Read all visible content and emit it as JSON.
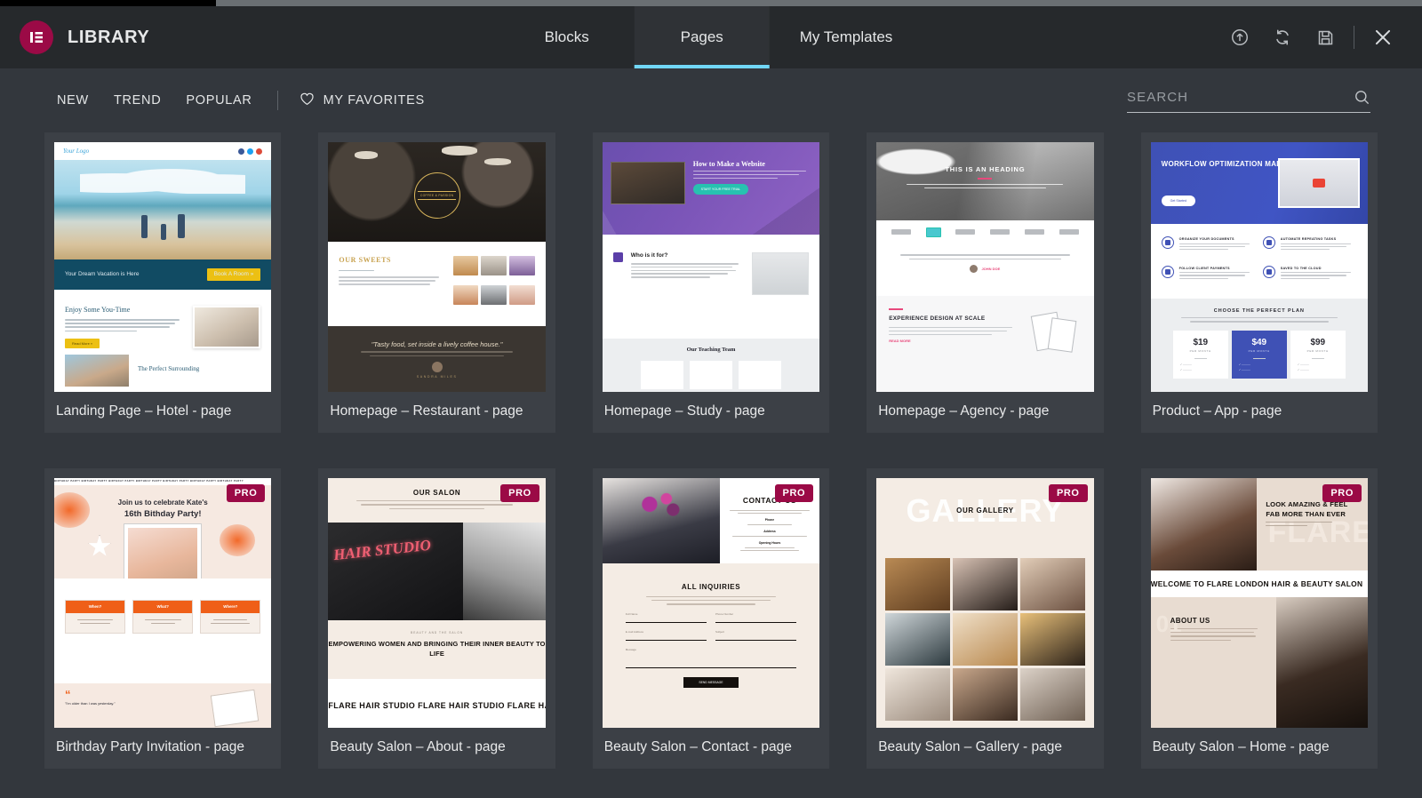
{
  "header": {
    "brand": "LIBRARY",
    "logo_color": "#9b0a46",
    "tabs": [
      {
        "label": "Blocks",
        "active": false
      },
      {
        "label": "Pages",
        "active": true
      },
      {
        "label": "My Templates",
        "active": false
      }
    ],
    "active_tab_underline_color": "#71d7f7",
    "actions": [
      {
        "name": "import-template-icon",
        "title": "Import Template"
      },
      {
        "name": "sync-library-icon",
        "title": "Sync Library"
      },
      {
        "name": "save-template-icon",
        "title": "Save"
      },
      {
        "name": "close-icon",
        "title": "Close"
      }
    ]
  },
  "toolbar": {
    "filters": [
      {
        "label": "NEW"
      },
      {
        "label": "TREND"
      },
      {
        "label": "POPULAR"
      }
    ],
    "favorites_label": "MY FAVORITES",
    "search": {
      "placeholder": "SEARCH",
      "value": ""
    }
  },
  "grid": {
    "pro_badge_label": "PRO",
    "pro_badge_color": "#9b0a46",
    "items": [
      {
        "title": "Landing Page – Hotel - page",
        "pro": false,
        "thumb": "hotel",
        "content": {
          "logo": "Your Logo",
          "band_text": "Your Dream Vacation is Here",
          "band_button": "Book A Room »",
          "section_heading": "Enjoy Some You-Time",
          "section_button": "Read More »",
          "bottom_caption": "The Perfect Surrounding"
        }
      },
      {
        "title": "Homepage – Restaurant - page",
        "pro": false,
        "thumb": "restaurant",
        "content": {
          "badge_text": "COFFEE & PASSION",
          "section_heading": "OUR SWEETS",
          "quote": "\"Tasty food, set inside a lively coffee house.\"",
          "author": "SANDRA MILES"
        }
      },
      {
        "title": "Homepage – Study - page",
        "pro": false,
        "thumb": "study",
        "content": {
          "hero_heading": "How to Make a Website",
          "hero_cta": "START YOUR FREE TRIAL",
          "section_heading": "Who is it for?",
          "team_heading": "Our Teaching Team"
        }
      },
      {
        "title": "Homepage – Agency - page",
        "pro": false,
        "thumb": "agency",
        "content": {
          "hero_heading": "THIS IS AN HEADING",
          "testimonial_author": "JOHN DOE",
          "section_heading": "EXPERIENCE DESIGN AT SCALE",
          "section_link": "READ MORE",
          "accent_color": "#e8497c"
        }
      },
      {
        "title": "Product – App - page",
        "pro": false,
        "thumb": "app",
        "content": {
          "hero_heading": "WORKFLOW OPTIMIZATION MADE EASY",
          "hero_cta": "Get Started",
          "features": [
            "ORGANIZE YOUR DOCUMENTS",
            "AUTOMATE REPEATING TASKS",
            "FOLLOW CLIENT PAYMENTS",
            "SAVED TO THE CLOUD"
          ],
          "pricing_heading": "CHOOSE THE PERFECT PLAN",
          "plans": [
            {
              "price": "$19",
              "period": "PER MONTH",
              "highlight": false
            },
            {
              "price": "$49",
              "period": "PER MONTH",
              "highlight": true
            },
            {
              "price": "$99",
              "period": "PER MONTH",
              "highlight": false
            }
          ],
          "accent_color": "#3f51b5"
        }
      },
      {
        "title": "Birthday Party Invitation - page",
        "pro": true,
        "thumb": "birthday",
        "content": {
          "marquee": "BIRTHDAY PARTY   BIRTHDAY PARTY   BIRTHDAY PARTY   BIRTHDAY PARTY   BIRTHDAY PARTY   BIRTHDAY PARTY   BIRTHDAY PARTY",
          "hero_line1": "Join us to celebrate Kate's",
          "hero_line2": "16th Bithday Party!",
          "info_cards": [
            {
              "title": "When?"
            },
            {
              "title": "What?"
            },
            {
              "title": "Where?"
            }
          ],
          "quote": "\"I'm older than I was yesterday.\"",
          "accent_color": "#ef5f18"
        }
      },
      {
        "title": "Beauty Salon – About - page",
        "pro": true,
        "thumb": "salon-about",
        "content": {
          "top_heading": "OUR SALON",
          "sign_text": "HAIR STUDIO",
          "mid_heading": "EMPOWERING WOMEN AND BRINGING THEIR INNER BEAUTY TO LIFE",
          "marquee": "FLARE HAIR STUDIO FLARE HAIR STUDIO FLARE HAIR"
        }
      },
      {
        "title": "Beauty Salon – Contact - page",
        "pro": true,
        "thumb": "salon-contact",
        "content": {
          "heading": "CONTACT US",
          "labels": [
            "Phone",
            "Address",
            "Opening Hours"
          ],
          "form_heading": "ALL INQUIRIES",
          "fields": [
            "Full Name",
            "Phone Number",
            "E-mail Address",
            "Subject",
            "Message"
          ],
          "submit_label": "SEND MESSAGE"
        }
      },
      {
        "title": "Beauty Salon – Gallery - page",
        "pro": true,
        "thumb": "salon-gallery",
        "content": {
          "watermark": "GALLERY",
          "heading": "OUR GALLERY"
        }
      },
      {
        "title": "Beauty Salon – Home - page",
        "pro": true,
        "thumb": "salon-home",
        "content": {
          "hero_heading": "LOOK AMAZING & FEEL FAB MORE THAN EVER",
          "watermark": "FLARE",
          "marquee": "WELCOME TO FLARE LONDON HAIR & BEAUTY SALON",
          "about_number": "01",
          "about_heading": "ABOUT US"
        }
      }
    ]
  }
}
